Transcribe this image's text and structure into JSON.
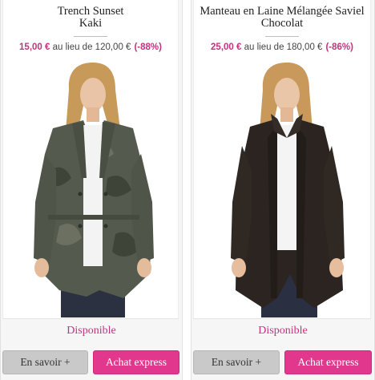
{
  "products": [
    {
      "title_line1": "Trench Sunset",
      "title_line2": "Kaki",
      "price_now": "15,00 €",
      "price_was_text": " au lieu de 120,00 €",
      "discount": "(-88%)",
      "availability": "Disponible",
      "more_label": "En savoir +",
      "buy_label": "Achat express",
      "image_subject": "woman-in-camo-khaki-trench-coat"
    },
    {
      "title_line1": "Manteau en Laine Mélangée Saviel",
      "title_line2": "Chocolat",
      "price_now": "25,00 €",
      "price_was_text": " au lieu de 180,00 €",
      "discount": "(-86%)",
      "availability": "Disponible",
      "more_label": "En savoir +",
      "buy_label": "Achat express",
      "image_subject": "woman-in-chocolate-wool-coat"
    }
  ],
  "colors": {
    "accent": "#e1378c",
    "price": "#c2327e",
    "button_grey": "#c9c9c9"
  }
}
